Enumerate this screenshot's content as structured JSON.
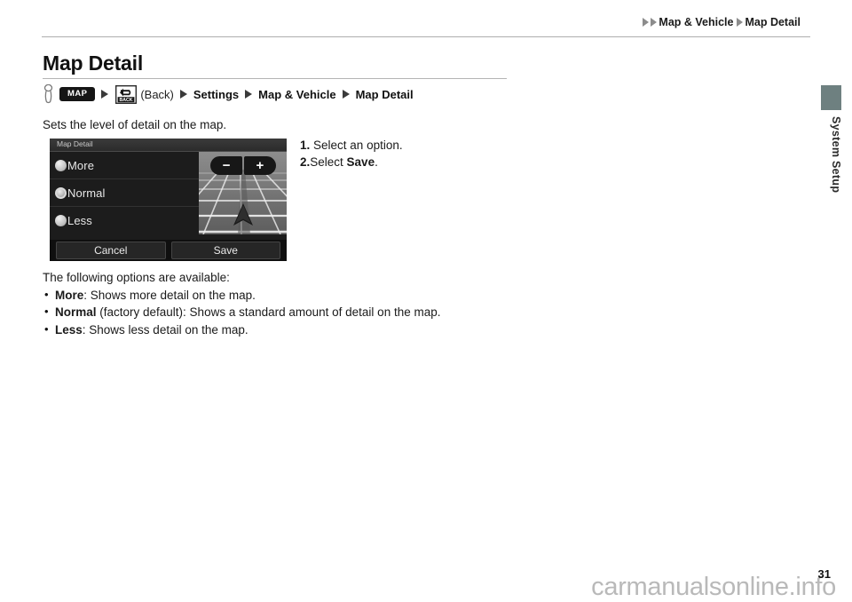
{
  "header": {
    "breadcrumb": [
      "Map & Vehicle",
      "Map Detail"
    ]
  },
  "page": {
    "title": "Map Detail",
    "number": "31",
    "watermark": "carmanualsonline.info"
  },
  "nav_path": {
    "finger_icon": "finger-press-icon",
    "map_button": "MAP",
    "back_icon": "back-button-icon",
    "back_label": "(Back)",
    "items": [
      "Settings",
      "Map & Vehicle",
      "Map Detail"
    ]
  },
  "body": {
    "intro": "Sets the level of detail on the map.",
    "steps": [
      {
        "num": "1.",
        "text": "Select an option.",
        "bold": ""
      },
      {
        "num": "2.",
        "text": "Select ",
        "bold": "Save",
        "suffix": "."
      }
    ],
    "options_heading": "The following options are available:",
    "options": [
      {
        "name": "More",
        "desc": ": Shows more detail on the map."
      },
      {
        "name": "Normal",
        "desc": " (factory default): Shows a standard amount of detail on the map."
      },
      {
        "name": "Less",
        "desc": ": Shows less detail on the map."
      }
    ]
  },
  "nav_screen": {
    "title": "Map Detail",
    "options": [
      {
        "label": "More",
        "selected": false
      },
      {
        "label": "Normal",
        "selected": true
      },
      {
        "label": "Less",
        "selected": false
      }
    ],
    "zoom_out": "−",
    "zoom_in": "+",
    "cancel": "Cancel",
    "save": "Save"
  },
  "sidebar": {
    "section_label": "System Setup",
    "tab_color": "#6e8080"
  }
}
